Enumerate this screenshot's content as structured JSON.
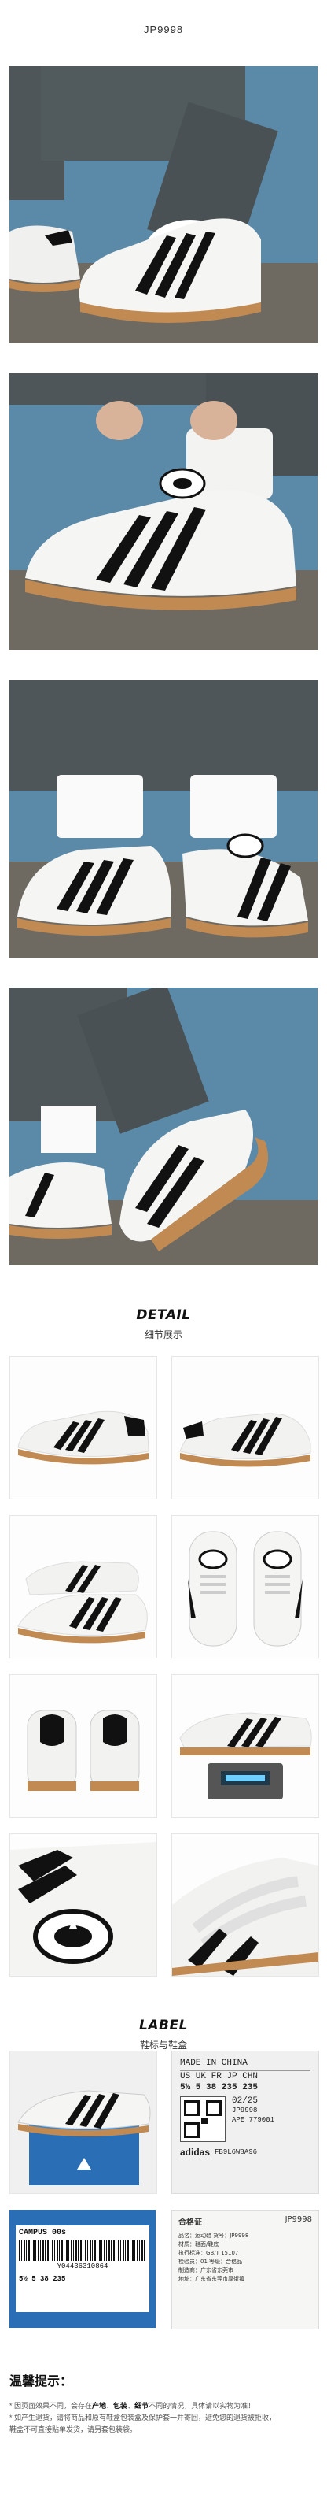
{
  "product_code": "JP9998",
  "detail": {
    "title_en": "DETAIL",
    "title_zh": "细节展示"
  },
  "label_section": {
    "title_en": "LABEL",
    "title_zh": "鞋标与鞋盒"
  },
  "shoe_label": {
    "made_in": "MADE IN CHINA",
    "size_header": "US  UK  FR  JP  CHN",
    "size_values": "5½  5   38  235  235",
    "date": "02/25",
    "code1": "JP9998",
    "code2": "APE 779001",
    "code3": "FB9L6W8A96",
    "brand": "adidas"
  },
  "box_label": {
    "model": "CAMPUS 00s",
    "barcode": "Y04436310864",
    "size_row": "5½  5  38  235"
  },
  "cert": {
    "title": "合格证",
    "code": "JP9998",
    "lines": [
      "品名：运动鞋  货号：JP9998",
      "材质：鞋面/鞋底",
      "执行标准：GB/T 15107",
      "检验员：01  等级：合格品",
      "制造商：广东省东莞市",
      "地址：广东省东莞市厚街镇"
    ]
  },
  "notes": {
    "title": "温馨提示：",
    "line1_pre": "* 因页面效果不同，会存在",
    "k1": "产地",
    "k2": "包装",
    "k3": "细节",
    "line1_post": "不同的情况，具体请以实物为准！",
    "line2": "* 如产生退货，请将商品和原有鞋盒包装盒及保护套一并寄回，避免您的退货被拒收，",
    "line3": "  鞋盒不可直接贴单发货，请另套包装袋。"
  },
  "colors": {
    "wall": "#5b89a8",
    "floor": "#6e6a62",
    "jeans": "#4f5659",
    "shoe": "#f5f5f3",
    "stripe": "#111111",
    "gum": "#c08a52"
  }
}
